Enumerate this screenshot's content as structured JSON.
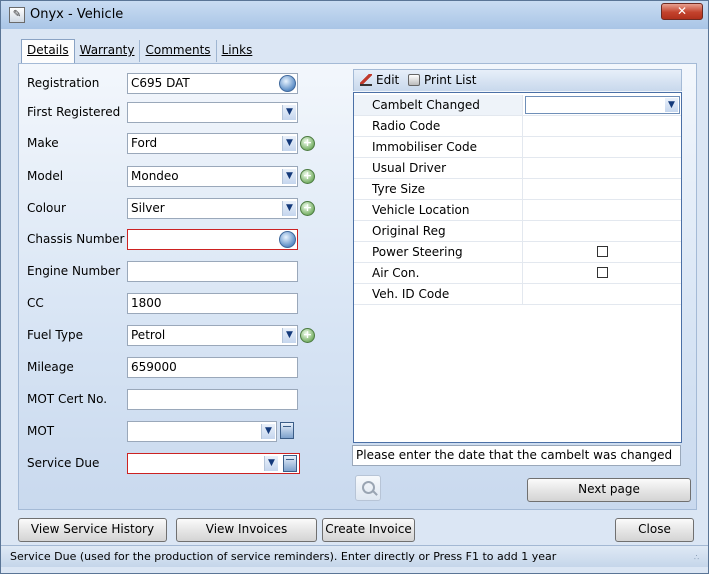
{
  "window": {
    "title": "Onyx - Vehicle",
    "close_glyph": "✕"
  },
  "tabs": [
    {
      "label": "Details"
    },
    {
      "label": "Warranty"
    },
    {
      "label": "Comments"
    },
    {
      "label": "Links"
    }
  ],
  "form": {
    "registration": {
      "label": "Registration",
      "value": "C695 DAT"
    },
    "first_registered": {
      "label": "First Registered",
      "value": ""
    },
    "make": {
      "label": "Make",
      "value": "Ford"
    },
    "model": {
      "label": "Model",
      "value": "Mondeo"
    },
    "colour": {
      "label": "Colour",
      "value": "Silver"
    },
    "chassis_number": {
      "label": "Chassis Number",
      "value": ""
    },
    "engine_number": {
      "label": "Engine Number",
      "value": ""
    },
    "cc": {
      "label": "CC",
      "value": "1800"
    },
    "fuel_type": {
      "label": "Fuel Type",
      "value": "Petrol"
    },
    "mileage": {
      "label": "Mileage",
      "value": "659000"
    },
    "mot_cert_no": {
      "label": "MOT Cert No.",
      "value": ""
    },
    "mot": {
      "label": "MOT",
      "value": ""
    },
    "service_due": {
      "label": "Service Due",
      "value": ""
    }
  },
  "grid_toolbar": {
    "edit_label": "Edit",
    "print_label": "Print List"
  },
  "grid_rows": [
    {
      "label": "Cambelt Changed",
      "value": ""
    },
    {
      "label": "Radio Code",
      "value": ""
    },
    {
      "label": "Immobiliser Code",
      "value": ""
    },
    {
      "label": "Usual Driver",
      "value": ""
    },
    {
      "label": "Tyre Size",
      "value": ""
    },
    {
      "label": "Vehicle Location",
      "value": ""
    },
    {
      "label": "Original Reg",
      "value": ""
    },
    {
      "label": "Power Steering",
      "checked": false
    },
    {
      "label": "Air Con.",
      "checked": false
    },
    {
      "label": "Veh. ID Code",
      "value": ""
    }
  ],
  "hint_text": "Please enter the date that the cambelt was changed",
  "buttons": {
    "next_page": "Next page",
    "view_service_history": "View Service History",
    "view_invoices": "View Invoices",
    "create_invoice": "Create Invoice",
    "close": "Close"
  },
  "status_text": "Service Due (used for the production of service reminders).  Enter directly or Press F1 to add 1 year",
  "colors": {
    "accent": "#4b70a6",
    "required_border": "#cc2222",
    "close_button": "#c3422d"
  },
  "icons": {
    "dropdown": "▼",
    "plus": "+",
    "grip": "∴"
  }
}
